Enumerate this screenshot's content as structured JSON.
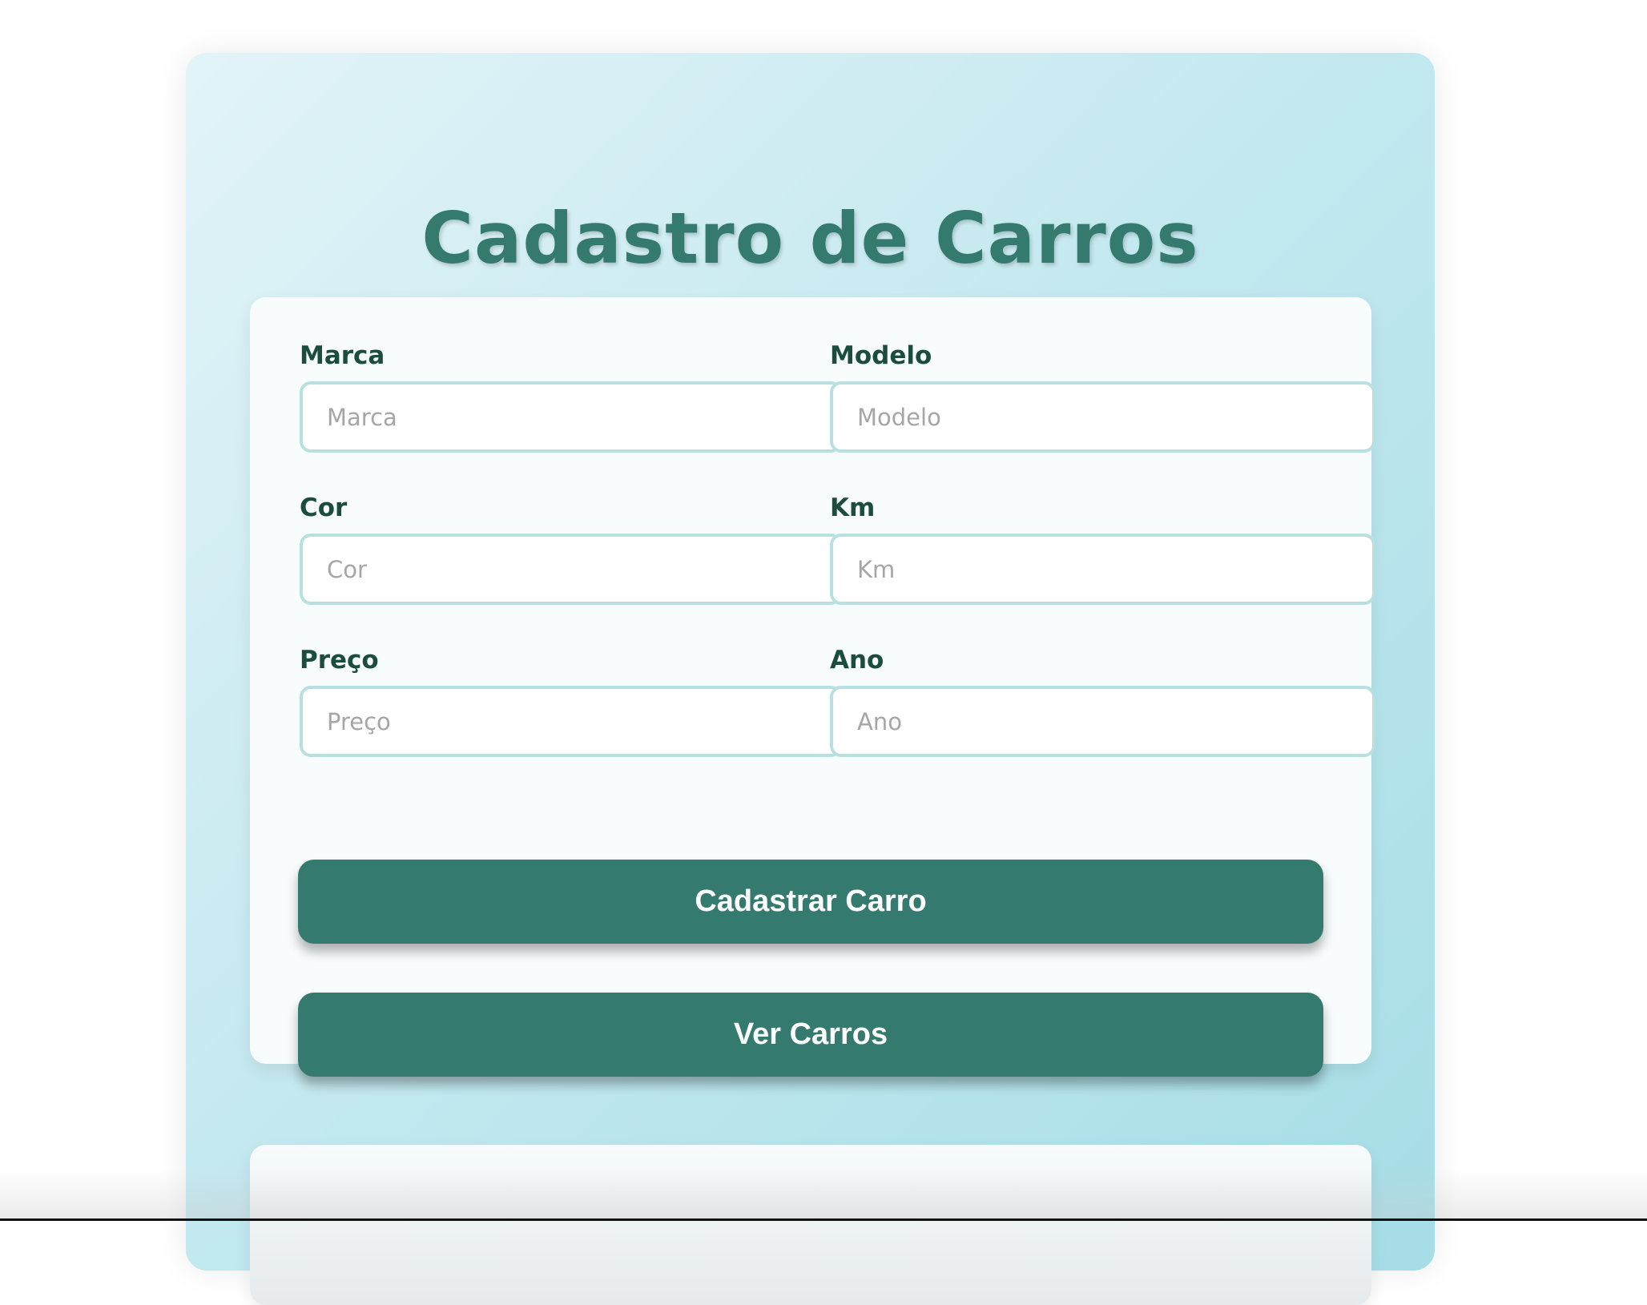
{
  "header": {
    "title": "Cadastro de Carros"
  },
  "form": {
    "fields": [
      {
        "label": "Marca",
        "placeholder": "Marca",
        "value": ""
      },
      {
        "label": "Modelo",
        "placeholder": "Modelo",
        "value": ""
      },
      {
        "label": "Cor",
        "placeholder": "Cor",
        "value": ""
      },
      {
        "label": "Km",
        "placeholder": "Km",
        "value": ""
      },
      {
        "label": "Preço",
        "placeholder": "Preço",
        "value": ""
      },
      {
        "label": "Ano",
        "placeholder": "Ano",
        "value": ""
      }
    ],
    "submit_label": "Cadastrar Carro",
    "view_label": "Ver Carros"
  },
  "colors": {
    "accent": "#357a6e",
    "label": "#1b4d3e",
    "input_border": "#b9e0e0"
  }
}
